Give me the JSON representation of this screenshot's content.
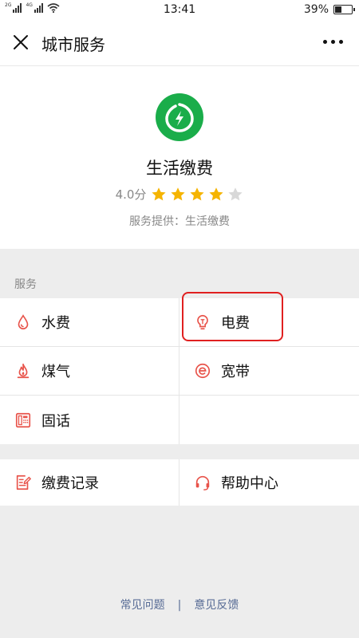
{
  "status_bar": {
    "network_1": "2G",
    "network_2": "4G",
    "time": "13:41",
    "battery_percent": "39%",
    "battery_level": 0.39
  },
  "nav": {
    "title": "城市服务"
  },
  "profile": {
    "name": "生活缴费",
    "rating_text": "4.0分",
    "rating_value": 4,
    "rating_max": 5,
    "provider": "服务提供：生活缴费",
    "logo_color": "#1aad4a"
  },
  "services": {
    "section_label": "服务",
    "items": [
      {
        "label": "水费",
        "icon": "water-drop-icon"
      },
      {
        "label": "电费",
        "icon": "lightbulb-icon"
      },
      {
        "label": "煤气",
        "icon": "flame-icon"
      },
      {
        "label": "宽带",
        "icon": "broadband-e-icon"
      },
      {
        "label": "固话",
        "icon": "telephone-icon"
      }
    ]
  },
  "extras": {
    "items": [
      {
        "label": "缴费记录",
        "icon": "record-edit-icon"
      },
      {
        "label": "帮助中心",
        "icon": "headset-icon"
      }
    ]
  },
  "footer": {
    "faq": "常见问题",
    "separator": "|",
    "feedback": "意见反馈"
  },
  "colors": {
    "accent_red": "#e8534a",
    "star_gold": "#f5b400",
    "star_empty": "#d8d8d8",
    "link_blue": "#576b95",
    "highlight_red": "#e02020"
  }
}
